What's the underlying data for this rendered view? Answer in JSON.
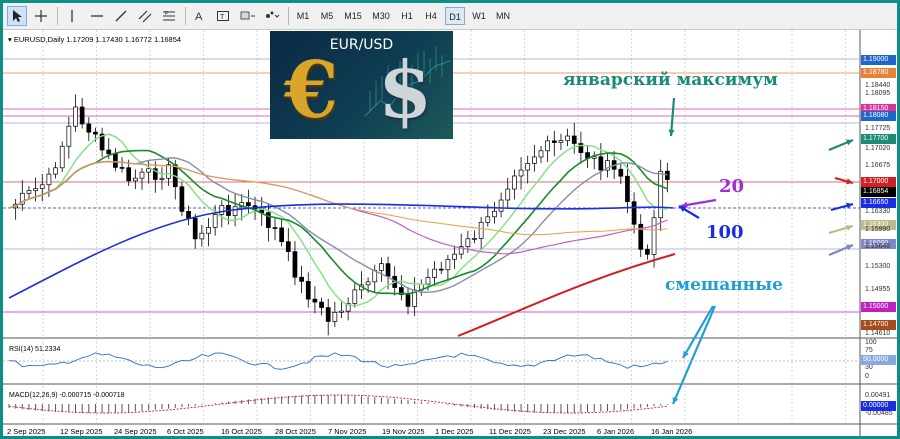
{
  "toolbar": {
    "timeframes": [
      "M1",
      "M5",
      "M15",
      "M30",
      "H1",
      "H4",
      "D1",
      "W1",
      "MN"
    ],
    "active_timeframe": "D1",
    "tools": [
      "cursor-icon",
      "crosshair-icon",
      "vertical-line-icon",
      "horizontal-line-icon",
      "trendline-icon",
      "channel-icon",
      "fibonacci-icon",
      "text-icon",
      "label-icon",
      "shapes-icon"
    ]
  },
  "chart": {
    "symbol_info": "EURUSD,Daily  1.17209 1.17430 1.16772 1.16854",
    "logo_title": "EUR/USD",
    "logo_euro": "€",
    "logo_dollar": "$"
  },
  "price_axis": {
    "ticks": [
      "1.18440",
      "1.18095",
      "1.17725",
      "1.17020",
      "1.16675",
      "1.16330",
      "1.15990",
      "1.15645",
      "1.15300",
      "1.14955",
      "1.14610"
    ],
    "labels": [
      {
        "text": "1.19000",
        "color": "#1f66c8"
      },
      {
        "text": "1.18780",
        "color": "#e8823a"
      },
      {
        "text": "1.18150",
        "color": "#e0309a"
      },
      {
        "text": "1.18080",
        "color": "#1f66c8"
      },
      {
        "text": "1.17700",
        "color": "#1b8a78"
      },
      {
        "text": "1.17000",
        "color": "#d02020"
      },
      {
        "text": "1.16854",
        "color": "#000000"
      },
      {
        "text": "1.16650",
        "color": "#1a2ee0"
      },
      {
        "text": "1.16300",
        "color": "#bdb98a"
      },
      {
        "text": "1.16000",
        "color": "#7f86c8"
      },
      {
        "text": "1.15000",
        "color": "#c020c0"
      },
      {
        "text": "1.14700",
        "color": "#a84a1a"
      }
    ]
  },
  "annotations": {
    "january_max": "январский максимум",
    "ma20": "20",
    "ma100": "100",
    "mixed": "смешанные"
  },
  "rsi": {
    "label": "RSI(14) 51.2334",
    "levels": [
      "100",
      "75",
      "50",
      "30",
      "0"
    ],
    "current": "50.0000"
  },
  "macd": {
    "label": "MACD(12,26,9) -0.000715 -0.000718",
    "levels": [
      "0.00491",
      "-0.00485"
    ],
    "current": "0.00000"
  },
  "dates": [
    "2 Sep 2025",
    "12 Sep 2025",
    "24 Sep 2025",
    "6 Oct 2025",
    "16 Oct 2025",
    "28 Oct 2025",
    "7 Nov 2025",
    "19 Nov 2025",
    "1 Dec 2025",
    "11 Dec 2025",
    "23 Dec 2025",
    "6 Jan 2026",
    "16 Jan 2026"
  ],
  "colors": {
    "frame": "#0c8f86",
    "bull": "#ffffff",
    "bear": "#000000",
    "ma_red": "#d02020",
    "ma_blue": "#1a2ee0",
    "ma_purple": "#c060c0",
    "ma_orange": "#e8a040",
    "ma_green": "#1a8a2a",
    "ma_lightgreen": "#80e080",
    "ma_gray": "#8090a8",
    "annotation_teal": "#1b8a78",
    "annotation_purple": "#9b30d8",
    "annotation_blue": "#1a2ee0",
    "annotation_sky": "#1f9ed8"
  }
}
